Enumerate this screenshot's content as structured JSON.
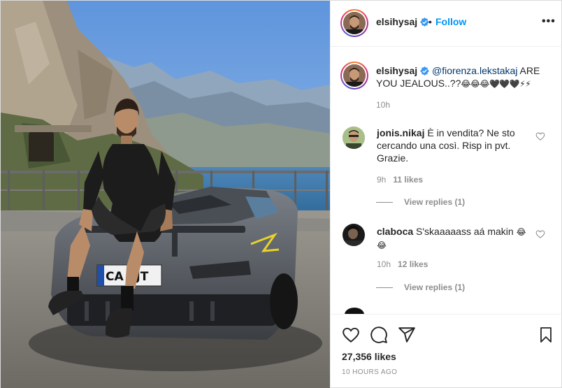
{
  "post": {
    "author": "elsihysaj",
    "follow_label": "Follow",
    "separator": "•",
    "more_label": "•••",
    "caption": {
      "user": "elsihysaj",
      "mention": "@fiorenza.lekstakaj",
      "text": " ARE YOU JEALOUS..??",
      "emojis": "😂😂😂🖤🖤🖤⚡⚡",
      "time": "10h"
    },
    "comments": [
      {
        "user": "jonis.nikaj",
        "text": "È in vendita? Ne sto cercando una così. Risp in pvt. Grazie.",
        "time": "9h",
        "likes": "11 likes",
        "view_replies": "View replies (1)"
      },
      {
        "user": "claboca",
        "text": "S'skaaaaass aá makin",
        "emoji": "😂 😂",
        "time": "10h",
        "likes": "12 likes",
        "view_replies": "View replies (1)"
      }
    ],
    "partial_comment": "...",
    "likes_count": "27,356 likes",
    "time_ago": "10 HOURS AGO"
  },
  "icons": {
    "verified": "verified-badge-icon",
    "heart": "heart-icon",
    "comment": "comment-icon",
    "share": "share-icon",
    "bookmark": "bookmark-icon",
    "more": "more-options-icon"
  },
  "colors": {
    "follow": "#0095f6",
    "muted": "#8e8e8e",
    "text": "#262626",
    "mention": "#00376b",
    "border": "#dbdbdb"
  }
}
